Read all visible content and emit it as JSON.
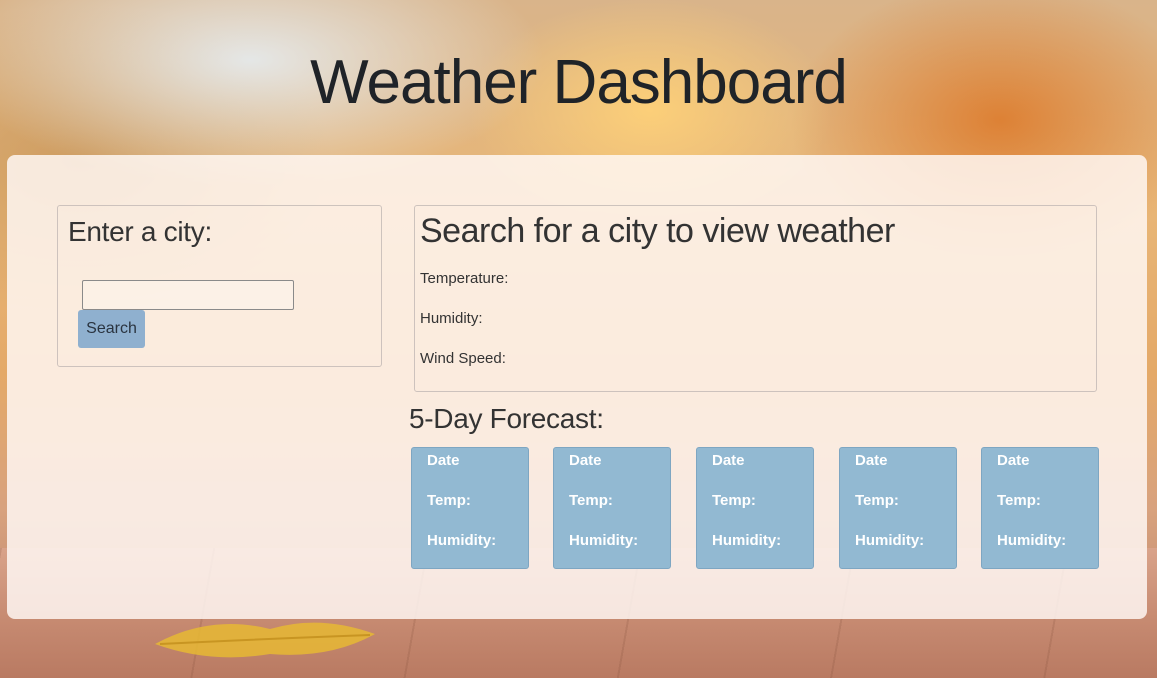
{
  "title": "Weather Dashboard",
  "search": {
    "label": "Enter a city:",
    "input_value": "",
    "button_label": "Search"
  },
  "current": {
    "heading": "Search for a city to view weather",
    "temperature_label": "Temperature:",
    "humidity_label": "Humidity:",
    "wind_label": "Wind Speed:"
  },
  "forecast": {
    "heading": "5-Day Forecast:",
    "cards": [
      {
        "date": "Date",
        "temp": "Temp:",
        "humidity": "Humidity:"
      },
      {
        "date": "Date",
        "temp": "Temp:",
        "humidity": "Humidity:"
      },
      {
        "date": "Date",
        "temp": "Temp:",
        "humidity": "Humidity:"
      },
      {
        "date": "Date",
        "temp": "Temp:",
        "humidity": "Humidity:"
      },
      {
        "date": "Date",
        "temp": "Temp:",
        "humidity": "Humidity:"
      }
    ]
  },
  "colors": {
    "card_background": "#92b9d2",
    "button_background": "#8fb0cf",
    "title_text": "#1f2328"
  }
}
